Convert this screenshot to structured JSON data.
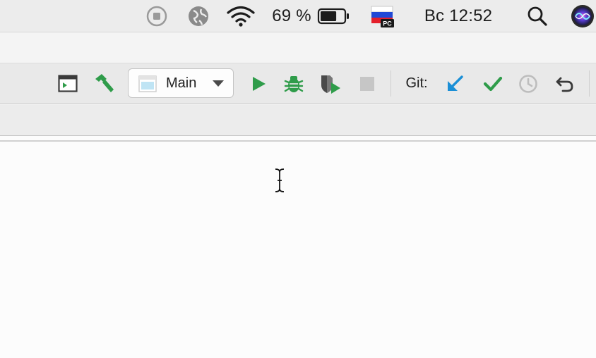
{
  "menubar": {
    "battery_percent": "69 %",
    "battery_level": 0.69,
    "clock": "Вс 12:52",
    "input_source_badge": "PC",
    "icons": [
      "screen-record-icon",
      "globe-icon",
      "wifi-icon",
      "battery-icon",
      "russian-flag-icon",
      "search-icon",
      "siri-icon"
    ]
  },
  "toolbar": {
    "run_config_label": "Main",
    "git_label": "Git:",
    "icons": [
      "project-window-icon",
      "build-hammer-icon",
      "run-icon",
      "debug-icon",
      "coverage-icon",
      "stop-icon",
      "git-update-icon",
      "git-commit-icon",
      "git-history-icon",
      "git-revert-icon"
    ],
    "colors": {
      "green": "#2f9c4a",
      "blue": "#1b8fd6",
      "gray": "#bdbdbd",
      "dark": "#4a4a4a"
    }
  }
}
